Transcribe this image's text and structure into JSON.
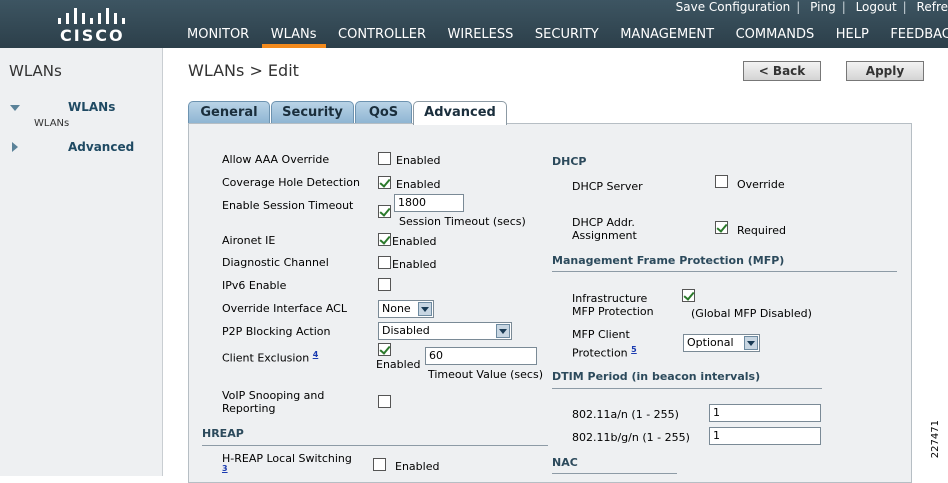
{
  "header": {
    "logo_text": "CISCO",
    "top_links": [
      "Save Configuration",
      "Ping",
      "Logout",
      "Refre"
    ],
    "nav": [
      "MONITOR",
      "WLANs",
      "CONTROLLER",
      "WIRELESS",
      "SECURITY",
      "MANAGEMENT",
      "COMMANDS",
      "HELP",
      "FEEDBACK"
    ],
    "active_nav": "WLANs",
    "accent_color": "#f28a1d"
  },
  "sidebar": {
    "title": "WLANs",
    "item_wlans": "WLANs",
    "item_wlans_sub": "WLANs",
    "item_advanced": "Advanced"
  },
  "main": {
    "title": "WLANs > Edit",
    "back_button": "< Back",
    "apply_button": "Apply",
    "tabs": [
      "General",
      "Security",
      "QoS",
      "Advanced"
    ],
    "active_tab": "Advanced"
  },
  "left_col": {
    "allow_aaa": "Allow AAA Override",
    "allow_aaa_val": "Enabled",
    "coverage_hole": "Coverage Hole Detection",
    "coverage_hole_val": "Enabled",
    "session_timeout": "Enable Session Timeout",
    "session_timeout_value": "1800",
    "session_timeout_unit": "Session Timeout (secs)",
    "aironet_ie": "Aironet IE",
    "aironet_ie_val": "Enabled",
    "diag_channel": "Diagnostic Channel",
    "diag_channel_val": "Enabled",
    "ipv6": "IPv6 Enable",
    "override_acl": "Override Interface ACL",
    "override_acl_val": "None",
    "p2p_blocking": "P2P Blocking Action",
    "p2p_blocking_val": "Disabled",
    "client_exclusion": "Client Exclusion",
    "client_exclusion_fn": "4",
    "client_exclusion_val": "Enabled",
    "client_exclusion_timeout": "60",
    "client_exclusion_timeout_unit": "Timeout Value (secs)",
    "voip_snooping_1": "VoIP Snooping and",
    "voip_snooping_2": "Reporting",
    "hreap_heading": "HREAP",
    "hreap_local_switching": "H-REAP Local Switching",
    "hreap_fn": "3",
    "hreap_val": "Enabled"
  },
  "right_col": {
    "dhcp_heading": "DHCP",
    "dhcp_server": "DHCP Server",
    "dhcp_server_val": "Override",
    "dhcp_addr_1": "DHCP Addr.",
    "dhcp_addr_2": "Assignment",
    "dhcp_addr_val": "Required",
    "mfp_heading": "Management Frame Protection (MFP)",
    "infra_mfp_1": "Infrastructure",
    "infra_mfp_2": "MFP Protection",
    "infra_mfp_note": "(Global MFP Disabled)",
    "mfp_client_1": "MFP Client",
    "mfp_client_2": "Protection",
    "mfp_client_fn": "5",
    "mfp_client_val": "Optional",
    "dtim_heading": "DTIM Period (in beacon intervals)",
    "dtim_an": "802.11a/n (1 - 255)",
    "dtim_an_val": "1",
    "dtim_bgn": "802.11b/g/n (1 - 255)",
    "dtim_bgn_val": "1",
    "nac_heading": "NAC"
  },
  "figure_id": "227471"
}
